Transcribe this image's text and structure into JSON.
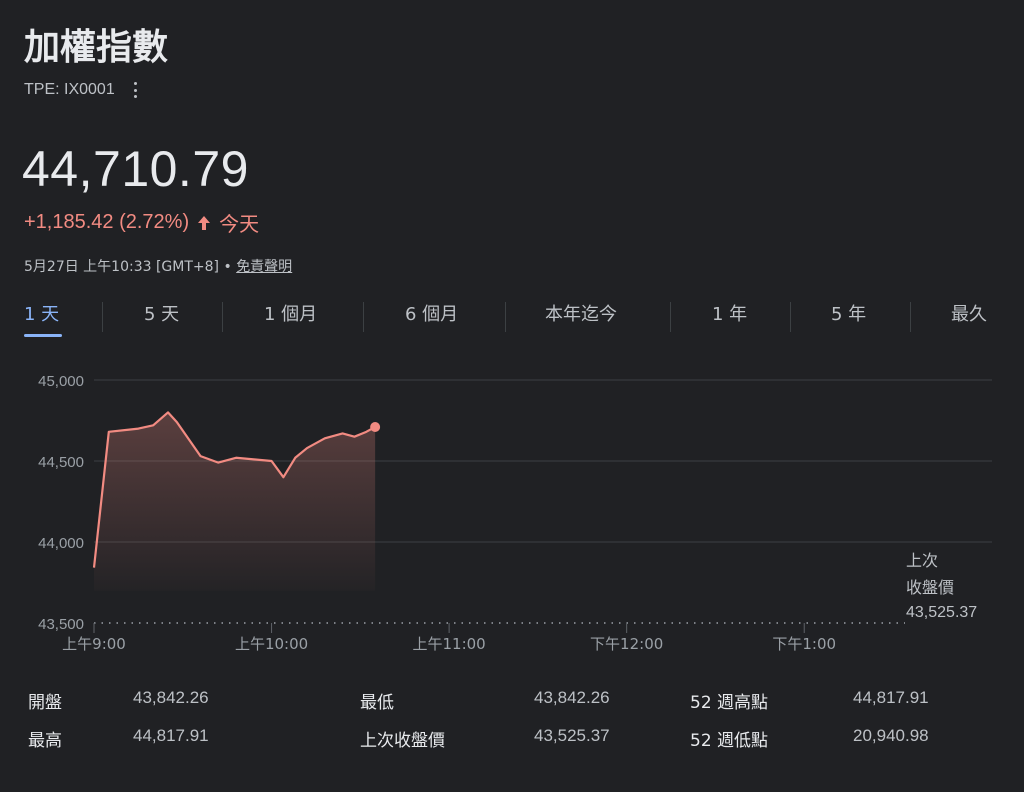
{
  "header": {
    "title": "加權指數",
    "ticker": "TPE: IX0001",
    "price": "44,710.79",
    "change": "+1,185.42 (2.72%)",
    "change_period": "今天",
    "timestamp": "5月27日 上午10:33 [GMT+8]",
    "separator": "•",
    "disclaimer": "免責聲明",
    "up_color": "#f28b82"
  },
  "tabs": [
    {
      "label": "1 天",
      "active": true
    },
    {
      "label": "5 天"
    },
    {
      "label": "1 個月"
    },
    {
      "label": "6 個月"
    },
    {
      "label": "本年迄今"
    },
    {
      "label": "1 年"
    },
    {
      "label": "5 年"
    },
    {
      "label": "最久"
    }
  ],
  "chart_data": {
    "type": "area",
    "y_ticks": [
      "45,000",
      "44,500",
      "44,000",
      "43,500"
    ],
    "ylim": [
      43500,
      45000
    ],
    "x_ticks": [
      "上午9:00",
      "上午10:00",
      "上午11:00",
      "下午12:00",
      "下午1:00"
    ],
    "x_tick_minutes": [
      0,
      60,
      120,
      180,
      240
    ],
    "xlim_minutes": [
      0,
      270
    ],
    "grid": true,
    "line_color": "#f28b82",
    "series": [
      {
        "x_minutes": [
          0,
          5,
          15,
          20,
          25,
          28,
          36,
          42,
          48,
          54,
          60,
          64,
          68,
          72,
          78,
          84,
          88,
          92,
          95
        ],
        "values": [
          43842,
          44680,
          44700,
          44720,
          44800,
          44740,
          44530,
          44490,
          44520,
          44510,
          44500,
          44400,
          44520,
          44580,
          44640,
          44670,
          44650,
          44680,
          44710
        ]
      }
    ],
    "prev_close": {
      "value": 43525.37,
      "label_line1": "上次",
      "label_line2": "收盤價",
      "label_value": "43,525.37"
    }
  },
  "stats": {
    "open_label": "開盤",
    "open_value": "43,842.26",
    "high_label": "最高",
    "high_value": "44,817.91",
    "low_label": "最低",
    "low_value": "43,842.26",
    "prev_close_label": "上次收盤價",
    "prev_close_value": "43,525.37",
    "w52_high_label": "52 週高點",
    "w52_high_value": "44,817.91",
    "w52_low_label": "52 週低點",
    "w52_low_value": "20,940.98"
  }
}
